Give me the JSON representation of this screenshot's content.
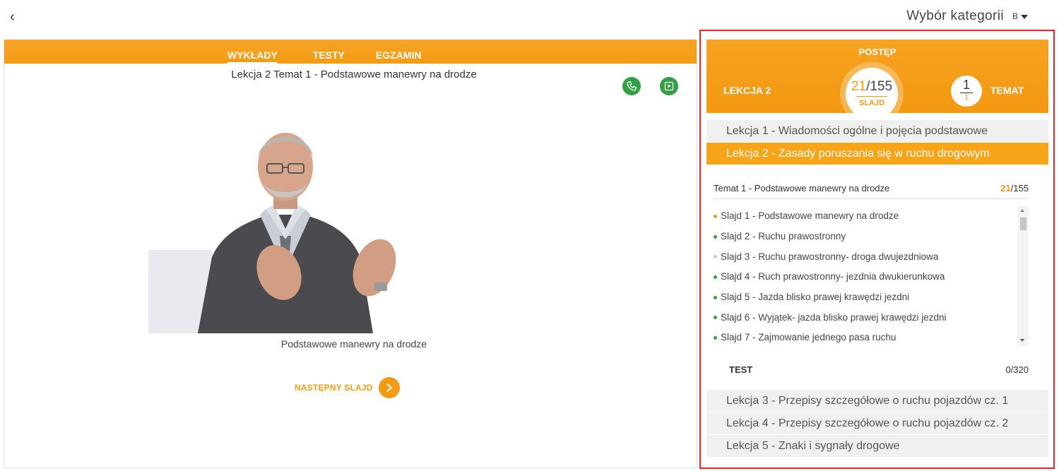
{
  "header": {
    "back_glyph": "‹",
    "category_label": "Wybór kategorii",
    "category_value": "B"
  },
  "tabs": [
    {
      "label": "WYKŁADY",
      "active": true
    },
    {
      "label": "TESTY",
      "active": false
    },
    {
      "label": "EGZAMIN",
      "active": false
    }
  ],
  "main": {
    "lesson_title": "Lekcja 2 Temat 1 - Podstawowe manewry na drodze",
    "video_caption": "Podstawowe manewry na drodze",
    "next_slide_label": "NASTĘPNY SLAJD",
    "icons": [
      "phone-icon",
      "play-icon"
    ]
  },
  "progress": {
    "title": "POSTĘP",
    "lesson_label": "LEKCJA 2",
    "slide_current": "21",
    "slide_total": "/155",
    "slide_label": "SLAJD",
    "topic_current": "1",
    "topic_total": "1",
    "topic_label": "TEMAT"
  },
  "lessons": [
    {
      "label": "Lekcja 1 - Wiadomości ogólne i pojęcia podstawowe",
      "active": false
    },
    {
      "label": "Lekcja 2 - Zasady poruszania się w ruchu drogowym",
      "active": true
    },
    {
      "label": "Lekcja 3 - Przepisy szczegółowe o ruchu pojazdów cz. 1",
      "active": false
    },
    {
      "label": "Lekcja 4 - Przepisy szczegółowe o ruchu pojazdów cz. 2",
      "active": false
    },
    {
      "label": "Lekcja 5 - Znaki i sygnały drogowe",
      "active": false
    }
  ],
  "topic": {
    "label": "Temat 1 - Podstawowe manewry na drodze",
    "current": "21",
    "total": "/155",
    "slides": [
      {
        "label": "Slajd 1 - Podstawowe manewry na drodze",
        "status": "current"
      },
      {
        "label": "Slajd 2 - Ruchu prawostronny",
        "status": "done"
      },
      {
        "label": "Slajd 3 - Ruchu prawostronny- droga dwujezdniowa",
        "status": "pending"
      },
      {
        "label": "Slajd 4 - Ruch prawostronny- jezdnia dwukierunkowa",
        "status": "done"
      },
      {
        "label": "Slajd 5 - Jazda blisko prawej krawędzi jezdni",
        "status": "done"
      },
      {
        "label": "Slajd 6 - Wyjątek- jazda blisko prawej krawędzi jezdni",
        "status": "done"
      },
      {
        "label": "Slajd 7 - Zajmowanie jednego pasa ruchu",
        "status": "done"
      }
    ],
    "test_label": "TEST",
    "test_current": "0",
    "test_total": "/320"
  },
  "colors": {
    "accent": "#f39b14",
    "green": "#34a046",
    "highlight_border": "#e3262f",
    "dot_current": "#f39b14",
    "dot_done": "#34a046",
    "dot_pending": "#cccccc"
  }
}
